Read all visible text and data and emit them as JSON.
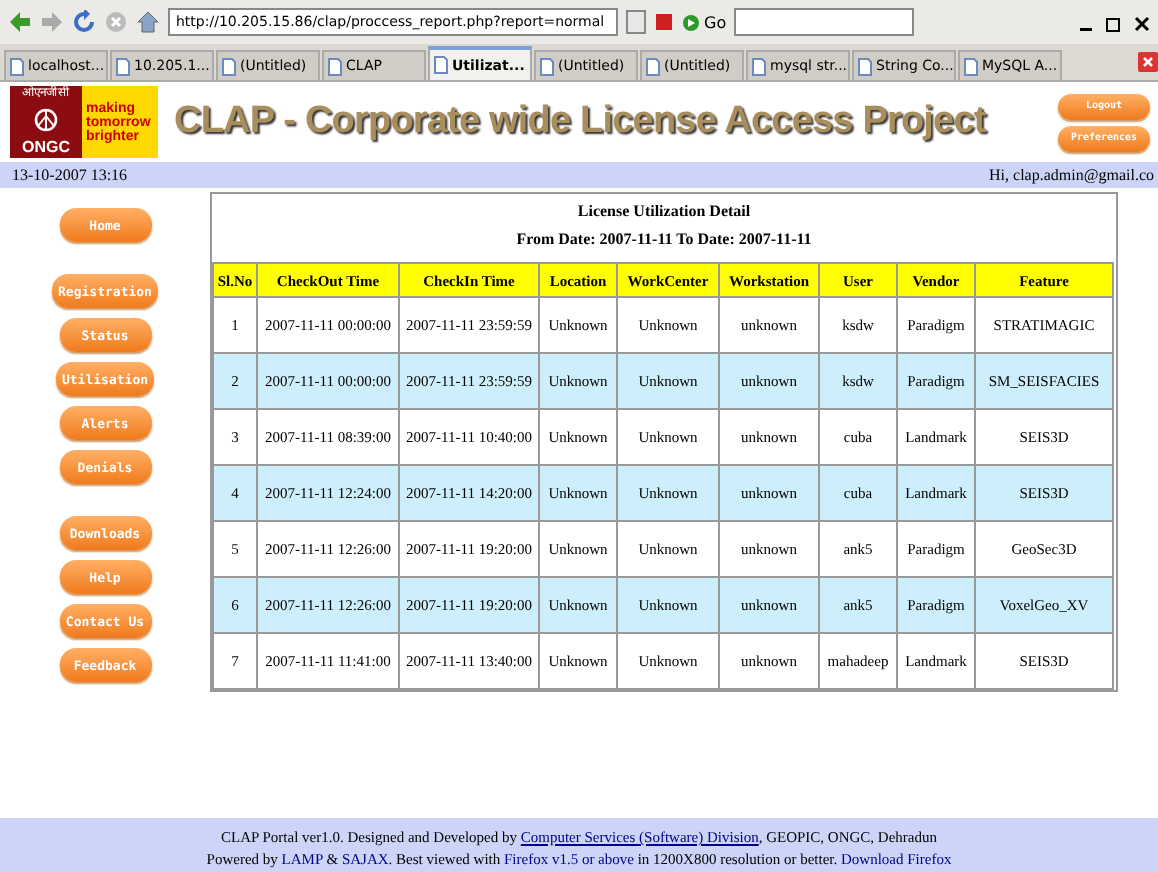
{
  "browser": {
    "url": "http://10.205.15.86/clap/proccess_report.php?report=normal",
    "go_label": "Go",
    "tabs": [
      {
        "label": "localhost...",
        "selected": false
      },
      {
        "label": "10.205.1...",
        "selected": false
      },
      {
        "label": "(Untitled)",
        "selected": false
      },
      {
        "label": "CLAP",
        "selected": false
      },
      {
        "label": "Utilizat...",
        "selected": true
      },
      {
        "label": "(Untitled)",
        "selected": false
      },
      {
        "label": "(Untitled)",
        "selected": false
      },
      {
        "label": "mysql str...",
        "selected": false
      },
      {
        "label": "String Co...",
        "selected": false
      },
      {
        "label": "MySQL A...",
        "selected": false
      }
    ]
  },
  "header": {
    "logo_hindi": "ओएनजीसी",
    "logo_name": "ONGC",
    "tagline": [
      "making",
      "tomorrow",
      "brighter"
    ],
    "title": "CLAP - Corporate wide License Access Project",
    "buttons": [
      "Logout",
      "Preferences"
    ]
  },
  "infobar": {
    "datetime": "13-10-2007 13:16",
    "greeting": "Hi, clap.admin@gmail.co"
  },
  "sidebar": {
    "groups": [
      {
        "items": [
          "Home"
        ]
      },
      {
        "items": [
          "Registration",
          "Status",
          "Utilisation",
          "Alerts",
          "Denials"
        ]
      },
      {
        "items": [
          "Downloads",
          "Help",
          "Contact Us",
          "Feedback"
        ]
      }
    ]
  },
  "report": {
    "title": "License Utilization Detail",
    "subtitle": "From Date: 2007-11-11 To Date: 2007-11-11",
    "columns": [
      "Sl.No",
      "CheckOut Time",
      "CheckIn Time",
      "Location",
      "WorkCenter",
      "Workstation",
      "User",
      "Vendor",
      "Feature"
    ],
    "rows": [
      [
        "1",
        "2007-11-11 00:00:00",
        "2007-11-11 23:59:59",
        "Unknown",
        "Unknown",
        "unknown",
        "ksdw",
        "Paradigm",
        "STRATIMAGIC"
      ],
      [
        "2",
        "2007-11-11 00:00:00",
        "2007-11-11 23:59:59",
        "Unknown",
        "Unknown",
        "unknown",
        "ksdw",
        "Paradigm",
        "SM_SEISFACIES"
      ],
      [
        "3",
        "2007-11-11 08:39:00",
        "2007-11-11 10:40:00",
        "Unknown",
        "Unknown",
        "unknown",
        "cuba",
        "Landmark",
        "SEIS3D"
      ],
      [
        "4",
        "2007-11-11 12:24:00",
        "2007-11-11 14:20:00",
        "Unknown",
        "Unknown",
        "unknown",
        "cuba",
        "Landmark",
        "SEIS3D"
      ],
      [
        "5",
        "2007-11-11 12:26:00",
        "2007-11-11 19:20:00",
        "Unknown",
        "Unknown",
        "unknown",
        "ank5",
        "Paradigm",
        "GeoSec3D"
      ],
      [
        "6",
        "2007-11-11 12:26:00",
        "2007-11-11 19:20:00",
        "Unknown",
        "Unknown",
        "unknown",
        "ank5",
        "Paradigm",
        "VoxelGeo_XV"
      ],
      [
        "7",
        "2007-11-11 11:41:00",
        "2007-11-11 13:40:00",
        "Unknown",
        "Unknown",
        "unknown",
        "mahadeep",
        "Landmark",
        "SEIS3D"
      ]
    ]
  },
  "footer": {
    "lines": [
      [
        {
          "kind": "text",
          "text": "CLAP Portal ver1.0. Designed and Developed by "
        },
        {
          "kind": "link",
          "text": "Computer Services (Software) Division"
        },
        {
          "kind": "text",
          "text": ", GEOPIC, ONGC, Dehradun"
        }
      ],
      [
        {
          "kind": "text",
          "text": "Powered by "
        },
        {
          "kind": "link",
          "text": "LAMP"
        },
        {
          "kind": "text",
          "text": " & "
        },
        {
          "kind": "link",
          "text": "SAJAX"
        },
        {
          "kind": "text",
          "text": ". Best viewed with "
        },
        {
          "kind": "link",
          "text": "Firefox v1.5 or above"
        },
        {
          "kind": "text",
          "text": " in 1200X800 resolution or better. "
        },
        {
          "kind": "link",
          "text": "Download Firefox"
        }
      ]
    ]
  }
}
